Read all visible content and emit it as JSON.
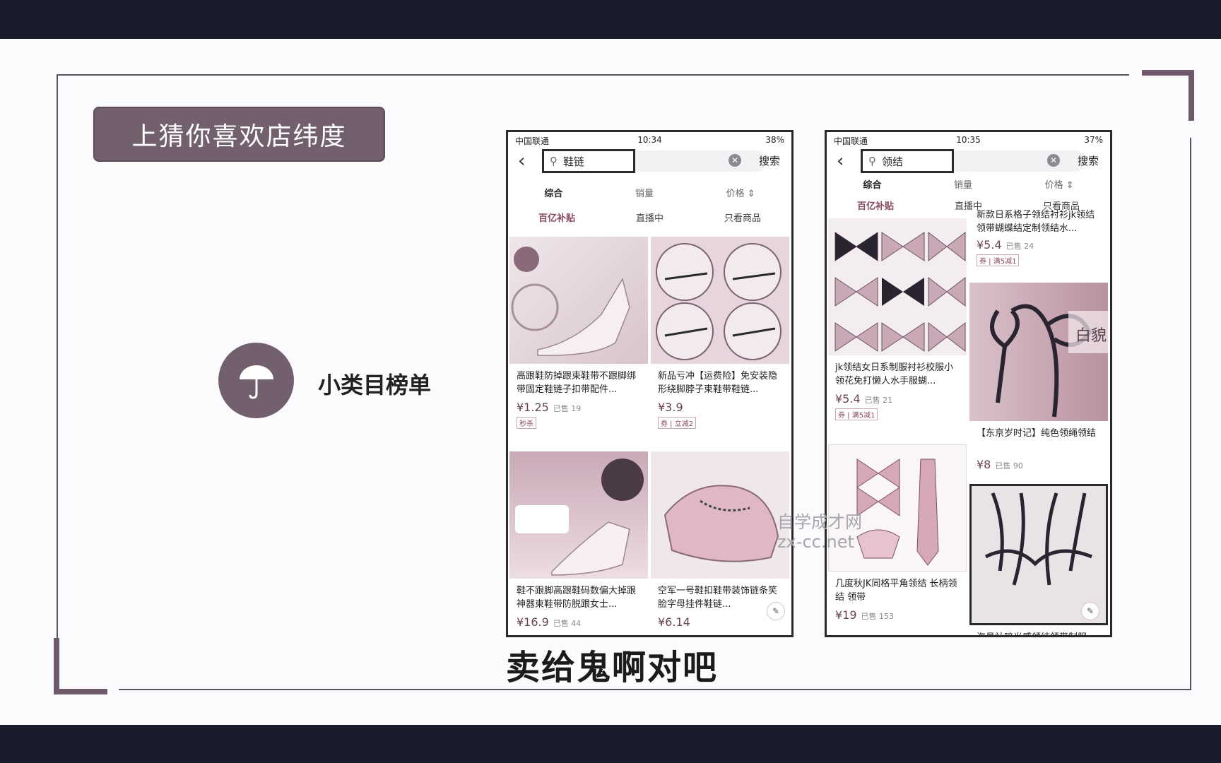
{
  "title_box": {
    "text": "上猜你喜欢店纬度"
  },
  "category": {
    "icon": "umbrella-icon",
    "label": "小类目榜单"
  },
  "subtitle": "卖给鬼啊对吧",
  "watermark": {
    "line1": "自学成才网",
    "line2": "zx-cc.net"
  },
  "colors": {
    "accent": "#73606f",
    "price": "#6a4356"
  },
  "phone_left": {
    "status": {
      "carrier": "中国联通",
      "time": "10:34",
      "battery": "38%"
    },
    "search": {
      "query": "鞋链",
      "button": "搜索"
    },
    "sort": [
      "综合",
      "销量",
      "价格 ⇕"
    ],
    "filters": [
      "百亿补贴",
      "直播中",
      "只看商品"
    ],
    "products": [
      {
        "title": "高跟鞋防掉跟束鞋带不跟脚绑带固定鞋链子扣带配件...",
        "price": "¥1.25",
        "sold": "已售 19",
        "tag": "秒杀"
      },
      {
        "title": "新品亏冲【运费险】免安装隐形绕脚脖子束鞋带鞋链...",
        "price": "¥3.9",
        "sold": "",
        "tag": "券 | 立减2"
      },
      {
        "title": "鞋不跟脚高跟鞋码数偏大掉跟神器束鞋带防脱跟女士...",
        "price": "¥16.9",
        "sold": "已售 44",
        "tag": ""
      },
      {
        "title": "空军一号鞋扣鞋带装饰链条笑脸字母挂件鞋链...",
        "price": "¥6.14",
        "sold": "",
        "tag": ""
      }
    ]
  },
  "phone_right": {
    "status": {
      "carrier": "中国联通",
      "time": "10:35",
      "battery": "37%"
    },
    "search": {
      "query": "领结",
      "button": "搜索"
    },
    "sort": [
      "综合",
      "销量",
      "价格 ⇕"
    ],
    "filters": [
      "百亿补贴",
      "直播中",
      "只看商品"
    ],
    "products": [
      {
        "title": "jk领结女日系制服衬衫校服小领花免打懒人水手服蝴...",
        "price": "¥5.4",
        "sold": "已售 21",
        "tag": "券 | 满5减1"
      },
      {
        "title": "几度秋JK同格平角领结 长柄领结 领带",
        "price": "¥19",
        "sold": "已售 153",
        "tag": ""
      },
      {
        "title": "新款日系格子领结衬衫jk领结领带蝴蝶结定制领结水...",
        "price": "¥5.4",
        "sold": "已售 24",
        "tag": "券 | 满5减1"
      },
      {
        "title": "【东京岁时记】纯色领绳领结",
        "price": "¥8",
        "sold": "已售 90",
        "tag": ""
      },
      {
        "title": "海员社暗光感领结领带制服",
        "price": "",
        "sold": "",
        "tag": ""
      }
    ],
    "overlay_text": "白貌"
  }
}
